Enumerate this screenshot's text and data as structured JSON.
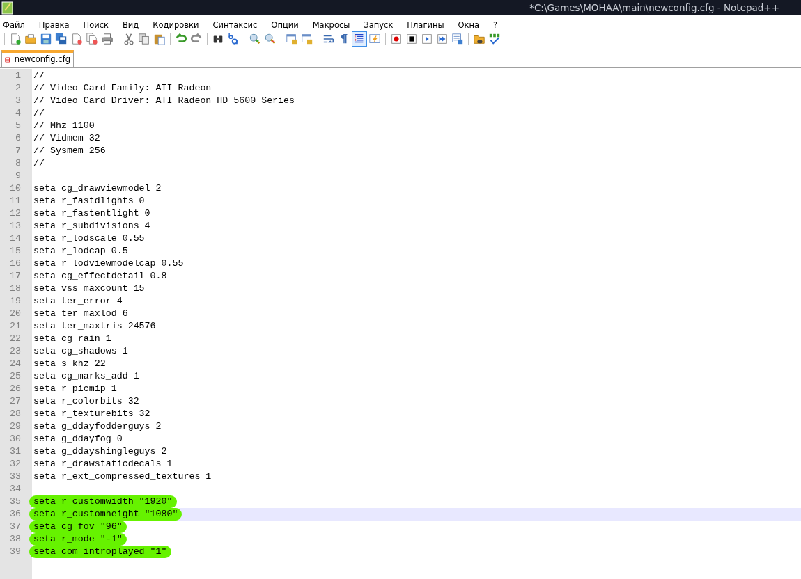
{
  "window": {
    "title": "*C:\\Games\\MOHAA\\main\\newconfig.cfg - Notepad++"
  },
  "menu": [
    "Файл",
    "Правка",
    "Поиск",
    "Вид",
    "Кодировки",
    "Синтаксис",
    "Опции",
    "Макросы",
    "Запуск",
    "Плагины",
    "Окна",
    "?"
  ],
  "toolbar": [
    [
      {
        "pressed": false
      },
      {
        "pressed": false
      },
      {
        "pressed": false
      },
      {
        "pressed": false
      },
      {
        "pressed": false
      },
      {
        "pressed": false
      },
      {
        "pressed": false
      }
    ],
    [
      {
        "pressed": false
      },
      {
        "pressed": false
      },
      {
        "pressed": false
      }
    ],
    [
      {
        "pressed": false
      },
      {
        "pressed": false
      }
    ],
    [
      {
        "pressed": false
      },
      {
        "pressed": false
      }
    ],
    [
      {
        "pressed": false
      },
      {
        "pressed": false
      }
    ],
    [
      {
        "pressed": false
      },
      {
        "pressed": false
      }
    ],
    [
      {
        "pressed": false
      },
      {
        "pressed": false
      },
      {
        "pressed": true
      },
      {
        "pressed": false
      }
    ],
    [
      {
        "pressed": false
      },
      {
        "pressed": false
      },
      {
        "pressed": false
      },
      {
        "pressed": false
      },
      {
        "pressed": false
      }
    ],
    [
      {
        "pressed": false
      },
      {
        "pressed": false
      }
    ]
  ],
  "tabs": [
    {
      "label": "newconfig.cfg",
      "selected": true,
      "modified": true
    }
  ],
  "editor": {
    "lines": [
      {
        "number": "1",
        "text": "//",
        "highlighted": false,
        "current": false
      },
      {
        "number": "2",
        "text": "// Video Card Family: ATI Radeon",
        "highlighted": false,
        "current": false
      },
      {
        "number": "3",
        "text": "// Video Card Driver: ATI Radeon HD 5600 Series",
        "highlighted": false,
        "current": false
      },
      {
        "number": "4",
        "text": "//",
        "highlighted": false,
        "current": false
      },
      {
        "number": "5",
        "text": "// Mhz 1100",
        "highlighted": false,
        "current": false
      },
      {
        "number": "6",
        "text": "// Vidmem 32",
        "highlighted": false,
        "current": false
      },
      {
        "number": "7",
        "text": "// Sysmem 256",
        "highlighted": false,
        "current": false
      },
      {
        "number": "8",
        "text": "//",
        "highlighted": false,
        "current": false
      },
      {
        "number": "9"
      },
      {
        "number": "10",
        "text": "seta cg_drawviewmodel 2",
        "highlighted": false,
        "current": false
      },
      {
        "number": "11",
        "text": "seta r_fastdlights 0",
        "highlighted": false,
        "current": false
      },
      {
        "number": "12",
        "text": "seta r_fastentlight 0",
        "highlighted": false,
        "current": false
      },
      {
        "number": "13",
        "text": "seta r_subdivisions 4",
        "highlighted": false,
        "current": false
      },
      {
        "number": "14",
        "text": "seta r_lodscale 0.55",
        "highlighted": false,
        "current": false
      },
      {
        "number": "15",
        "text": "seta r_lodcap 0.5",
        "highlighted": false,
        "current": false
      },
      {
        "number": "16",
        "text": "seta r_lodviewmodelcap 0.55",
        "highlighted": false,
        "current": false
      },
      {
        "number": "17",
        "text": "seta cg_effectdetail 0.8",
        "highlighted": false,
        "current": false
      },
      {
        "number": "18",
        "text": "seta vss_maxcount 15",
        "highlighted": false,
        "current": false
      },
      {
        "number": "19",
        "text": "seta ter_error 4",
        "highlighted": false,
        "current": false
      },
      {
        "number": "20",
        "text": "seta ter_maxlod 6",
        "highlighted": false,
        "current": false
      },
      {
        "number": "21",
        "text": "seta ter_maxtris 24576",
        "highlighted": false,
        "current": false
      },
      {
        "number": "22",
        "text": "seta cg_rain 1",
        "highlighted": false,
        "current": false
      },
      {
        "number": "23",
        "text": "seta cg_shadows 1",
        "highlighted": false,
        "current": false
      },
      {
        "number": "24",
        "text": "seta s_khz 22",
        "highlighted": false,
        "current": false
      },
      {
        "number": "25",
        "text": "seta cg_marks_add 1",
        "highlighted": false,
        "current": false
      },
      {
        "number": "26",
        "text": "seta r_picmip 1",
        "highlighted": false,
        "current": false
      },
      {
        "number": "27",
        "text": "seta r_colorbits 32",
        "highlighted": false,
        "current": false
      },
      {
        "number": "28",
        "text": "seta r_texturebits 32",
        "highlighted": false,
        "current": false
      },
      {
        "number": "29",
        "text": "seta g_ddayfodderguys 2",
        "highlighted": false,
        "current": false
      },
      {
        "number": "30",
        "text": "seta g_ddayfog 0",
        "highlighted": false,
        "current": false
      },
      {
        "number": "31",
        "text": "seta g_ddayshingleguys 2",
        "highlighted": false,
        "current": false
      },
      {
        "number": "32",
        "text": "seta r_drawstaticdecals 1",
        "highlighted": false,
        "current": false
      },
      {
        "number": "33",
        "text": "seta r_ext_compressed_textures 1",
        "highlighted": false,
        "current": false
      },
      {
        "number": "34"
      },
      {
        "number": "35",
        "text": "seta r_customwidth \"1920\"",
        "highlighted": true,
        "current": false
      },
      {
        "number": "36",
        "text": "seta r_customheight \"1080\"",
        "highlighted": true,
        "current": true
      },
      {
        "number": "37",
        "text": "seta cg_fov \"96\"",
        "highlighted": true,
        "current": false
      },
      {
        "number": "38",
        "text": "seta r_mode \"-1\"",
        "highlighted": true,
        "current": false
      },
      {
        "number": "39",
        "text": "seta com_introplayed \"1\"",
        "highlighted": true,
        "current": false
      }
    ]
  }
}
